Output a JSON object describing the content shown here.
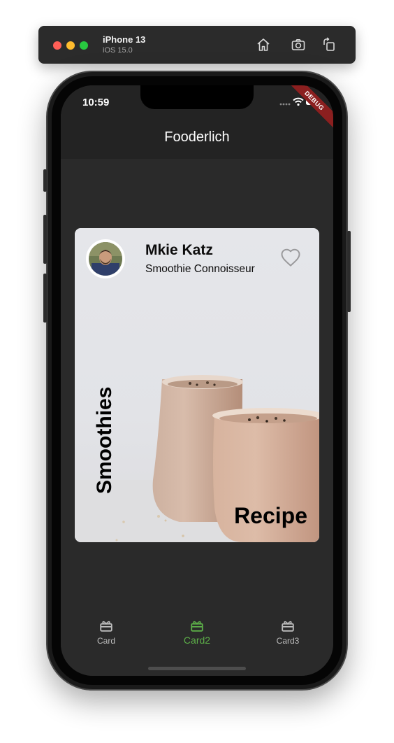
{
  "simulator": {
    "device_name": "iPhone 13",
    "os_version": "iOS 15.0",
    "buttons": [
      {
        "icon": "home-icon"
      },
      {
        "icon": "screenshot-icon"
      },
      {
        "icon": "rotate-icon"
      }
    ]
  },
  "status_bar": {
    "time": "10:59",
    "debug_banner": "DEBUG"
  },
  "app_bar": {
    "title": "Fooderlich"
  },
  "card": {
    "author_name": "Mkie Katz",
    "author_role": "Smoothie Connoisseur",
    "vertical_title": "Smoothies",
    "corner_label": "Recipe",
    "favorite_icon": "heart-outline-icon"
  },
  "bottom_nav": {
    "items": [
      {
        "label": "Card",
        "icon": "card-icon",
        "selected": false
      },
      {
        "label": "Card2",
        "icon": "card-icon",
        "selected": true
      },
      {
        "label": "Card3",
        "icon": "card-icon",
        "selected": false
      }
    ],
    "active_color": "#5cae48",
    "inactive_color": "#bdbdbd"
  }
}
